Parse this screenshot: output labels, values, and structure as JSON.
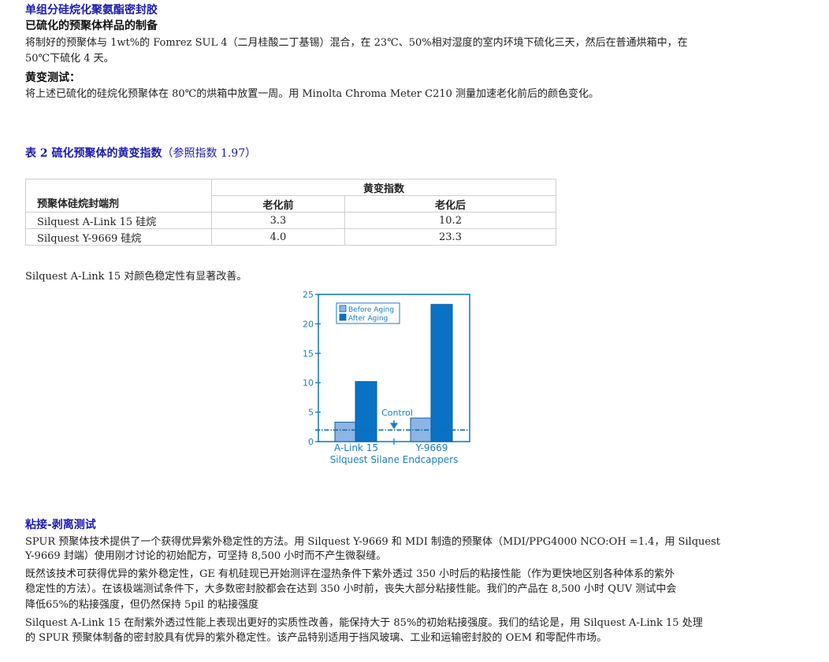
{
  "section1": {
    "title": "单组分硅烷化聚氨酯密封胶",
    "subtitle": "已硫化的预聚体样品的制备",
    "para1a": "将制好的预聚体与 1wt%的 Fomrez SUL 4（二月桂酸二丁基锡）混合，在 23℃、50%相对湿度的室内环境下硫化三天，然后在普通烘箱中，在",
    "para1b": "50℃下硫化 4 天。",
    "yellow_title": "黄变测试：",
    "para2": "将上述已硫化的硅烷化预聚体在 80℃的烘箱中放置一周。用 Minolta Chroma Meter C210 测量加速老化前后的颜色变化。"
  },
  "table2": {
    "caption_bold": "表 2 硫化预聚体的黄变指数",
    "caption_normal": "（参照指数 1.97）",
    "col_group": "黄变指数",
    "col_endcapper": "预聚体硅烷封端剂",
    "col_before": "老化前",
    "col_after": "老化后",
    "rows": [
      {
        "name": "Silquest A-Link 15 硅烷",
        "before": "3.3",
        "after": "10.2"
      },
      {
        "name": "Silquest Y-9669 硅烷",
        "before": "4.0",
        "after": "23.3"
      }
    ]
  },
  "chart_note": "Silquest A-Link 15 对颜色稳定性有显著改善。",
  "chart_data": {
    "type": "bar",
    "categories": [
      "A-Link 15",
      "Y-9669"
    ],
    "series": [
      {
        "name": "Before Aging",
        "values": [
          3.3,
          4.0
        ],
        "color": "#8db4e2"
      },
      {
        "name": "After Aging",
        "values": [
          10.2,
          23.3
        ],
        "color": "#0a72c4"
      }
    ],
    "yticks": [
      "0",
      "5",
      "10",
      "15",
      "20",
      "25"
    ],
    "ylim": [
      0,
      25
    ],
    "xlabel": "Silquest Silane Endcappers",
    "reference": {
      "label": "Control",
      "value": 1.97
    },
    "axis_color": "#1a7fc4",
    "legend_position": "top-left"
  },
  "section3": {
    "title": "粘接-剥离测试",
    "p1a": "SPUR 预聚体技术提供了一个获得优异紫外稳定性的方法。用 Silquest Y-9669 和 MDI 制造的预聚体（MDI/PPG4000 NCO:OH =1.4，用 Silquest",
    "p1b": "Y-9669 封端）使用刚才讨论的初始配方，可坚持 8,500 小时而不产生微裂缝。",
    "p2a": "既然该技术可获得优异的紫外稳定性，GE 有机硅现已开始测评在湿热条件下紫外透过 350 小时后的粘接性能（作为更快地区别各种体系的紫外",
    "p2b": "稳定性的方法）。在该极端测试条件下，大多数密封胶都会在达到 350 小时前，丧失大部分粘接性能。我们的产品在 8,500 小时 QUV 测试中会",
    "p2c": "降低65%的粘接强度，但仍然保持 5pil 的粘接强度",
    "p3a": "Silquest A-Link 15 在耐紫外透过性能上表现出更好的实质性改善，能保持大于 85%的初始粘接强度。我们的结论是，用 Silquest A-Link 15 处理",
    "p3b": "的 SPUR 预聚体制备的密封胶具有优异的紫外稳定性。该产品特别适用于挡风玻璃、工业和运输密封胶的 OEM 和零配件市场。"
  }
}
